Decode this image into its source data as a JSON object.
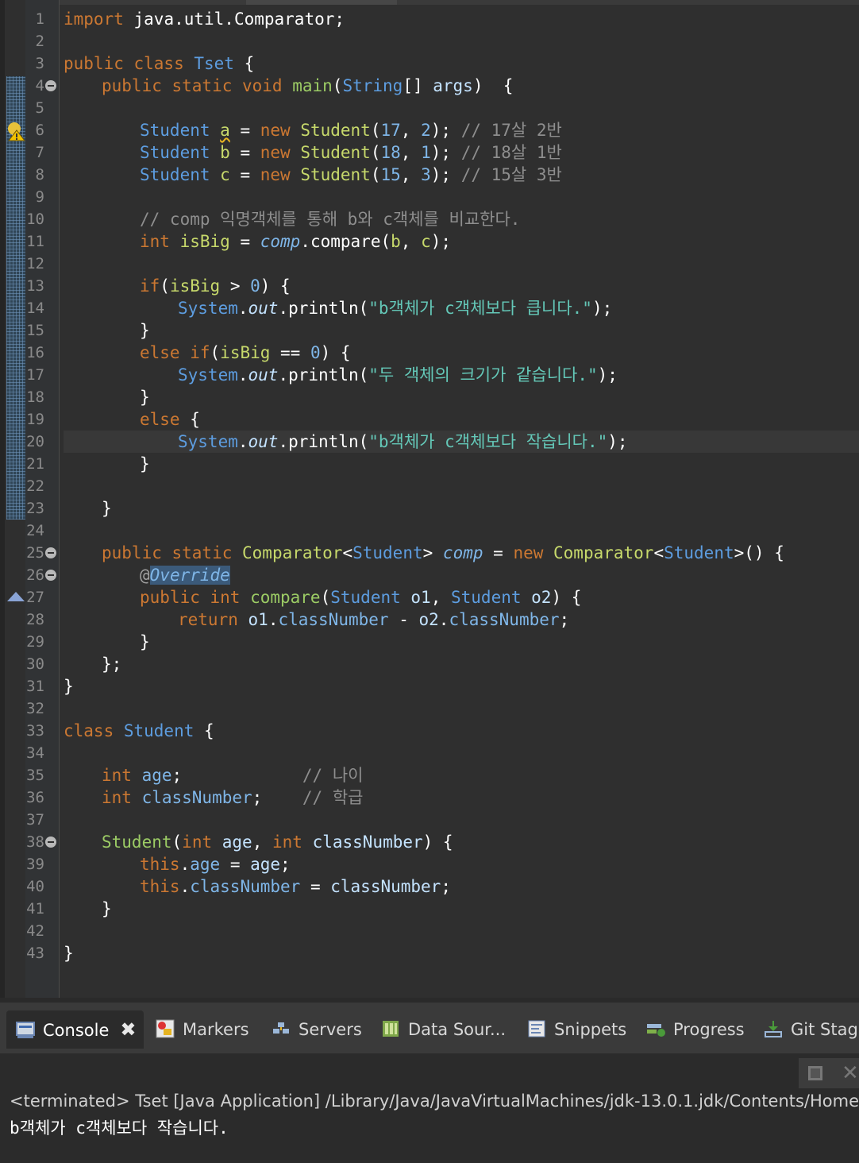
{
  "editor": {
    "line_numbers": [
      "1",
      "2",
      "3",
      "4",
      "5",
      "6",
      "7",
      "8",
      "9",
      "10",
      "11",
      "12",
      "13",
      "14",
      "15",
      "16",
      "17",
      "18",
      "19",
      "20",
      "21",
      "22",
      "23",
      "24",
      "25",
      "26",
      "27",
      "28",
      "29",
      "30",
      "31",
      "32",
      "33",
      "34",
      "35",
      "36",
      "37",
      "38",
      "39",
      "40",
      "41",
      "42",
      "43"
    ],
    "code": {
      "l1": [
        "import ",
        "java.util.Comparator;"
      ],
      "l3": [
        "public class ",
        "Tset",
        " {"
      ],
      "l4": [
        "public static void ",
        "main",
        "(",
        "String",
        "[] ",
        "args",
        ")  {"
      ],
      "l6": [
        "Student ",
        "a",
        " = ",
        "new ",
        "Student",
        "(",
        "17",
        ", ",
        "2",
        "); ",
        "// 17살 2반"
      ],
      "l7": [
        "Student ",
        "b",
        " = ",
        "new ",
        "Student",
        "(",
        "18",
        ", ",
        "1",
        "); ",
        "// 18살 1반"
      ],
      "l8": [
        "Student ",
        "c",
        " = ",
        "new ",
        "Student",
        "(",
        "15",
        ", ",
        "3",
        "); ",
        "// 15살 3반"
      ],
      "l10": [
        "// comp 익명객체를 통해 b와 c객체를 비교한다."
      ],
      "l11": [
        "int ",
        "isBig",
        " = ",
        "comp",
        ".compare(",
        "b",
        ", ",
        "c",
        ");"
      ],
      "l13": [
        "if",
        "(",
        "isBig",
        " > ",
        "0",
        ") {"
      ],
      "l14": [
        "System",
        ".",
        "out",
        ".println(",
        "\"b객체가 c객체보다 큽니다.\"",
        ");"
      ],
      "l15": [
        "}"
      ],
      "l16": [
        "else if",
        "(",
        "isBig",
        " == ",
        "0",
        ") {"
      ],
      "l17": [
        "System",
        ".",
        "out",
        ".println(",
        "\"두 객체의 크기가 같습니다.\"",
        ");"
      ],
      "l18": [
        "}"
      ],
      "l19": [
        "else",
        " {"
      ],
      "l20": [
        "System",
        ".",
        "out",
        ".println(",
        "\"b객체가 c객체보다 작습니다.\"",
        ");"
      ],
      "l21": [
        "}"
      ],
      "l23": [
        "}"
      ],
      "l25": [
        "public static ",
        "Comparator",
        "<",
        "Student",
        "> ",
        "comp",
        " = ",
        "new ",
        "Comparator",
        "<",
        "Student",
        ">() {"
      ],
      "l26": [
        "@",
        "Override"
      ],
      "l27": [
        "public int ",
        "compare",
        "(",
        "Student ",
        "o1",
        ", ",
        "Student ",
        "o2",
        ") {"
      ],
      "l28": [
        "return ",
        "o1",
        ".",
        "classNumber",
        " - ",
        "o2",
        ".",
        "classNumber",
        ";"
      ],
      "l29": [
        "}"
      ],
      "l30": [
        "};"
      ],
      "l31": [
        "}"
      ],
      "l33": [
        "class ",
        "Student",
        " {"
      ],
      "l35": [
        "int ",
        "age",
        ";",
        "            // 나이"
      ],
      "l36": [
        "int ",
        "classNumber",
        ";",
        "    // 학급"
      ],
      "l38": [
        "Student",
        "(",
        "int ",
        "age",
        ", ",
        "int ",
        "classNumber",
        ") {"
      ],
      "l39": [
        "this",
        ".",
        "age",
        " = ",
        "age",
        ";"
      ],
      "l40": [
        "this",
        ".",
        "classNumber",
        " = ",
        "classNumber",
        ";"
      ],
      "l41": [
        "}"
      ],
      "l43": [
        "}"
      ]
    }
  },
  "tabs": [
    {
      "label": "Console",
      "icon": "console-icon"
    },
    {
      "label": "Markers",
      "icon": "markers-icon"
    },
    {
      "label": "Servers",
      "icon": "servers-icon"
    },
    {
      "label": "Data Sour...",
      "icon": "data-source-icon"
    },
    {
      "label": "Snippets",
      "icon": "snippets-icon"
    },
    {
      "label": "Progress",
      "icon": "progress-icon"
    },
    {
      "label": "Git Stag",
      "icon": "git-staging-icon"
    }
  ],
  "console": {
    "terminated_line": "<terminated> Tset [Java Application] /Library/Java/JavaVirtualMachines/jdk-13.0.1.jdk/Contents/Home",
    "output": "b객체가 c객체보다 작습니다."
  },
  "colors": {
    "keyword": "#cc7832",
    "type": "#5d9de0",
    "string": "#64c8b8",
    "comment": "#8e8e8e",
    "background": "#2f2f2f"
  }
}
